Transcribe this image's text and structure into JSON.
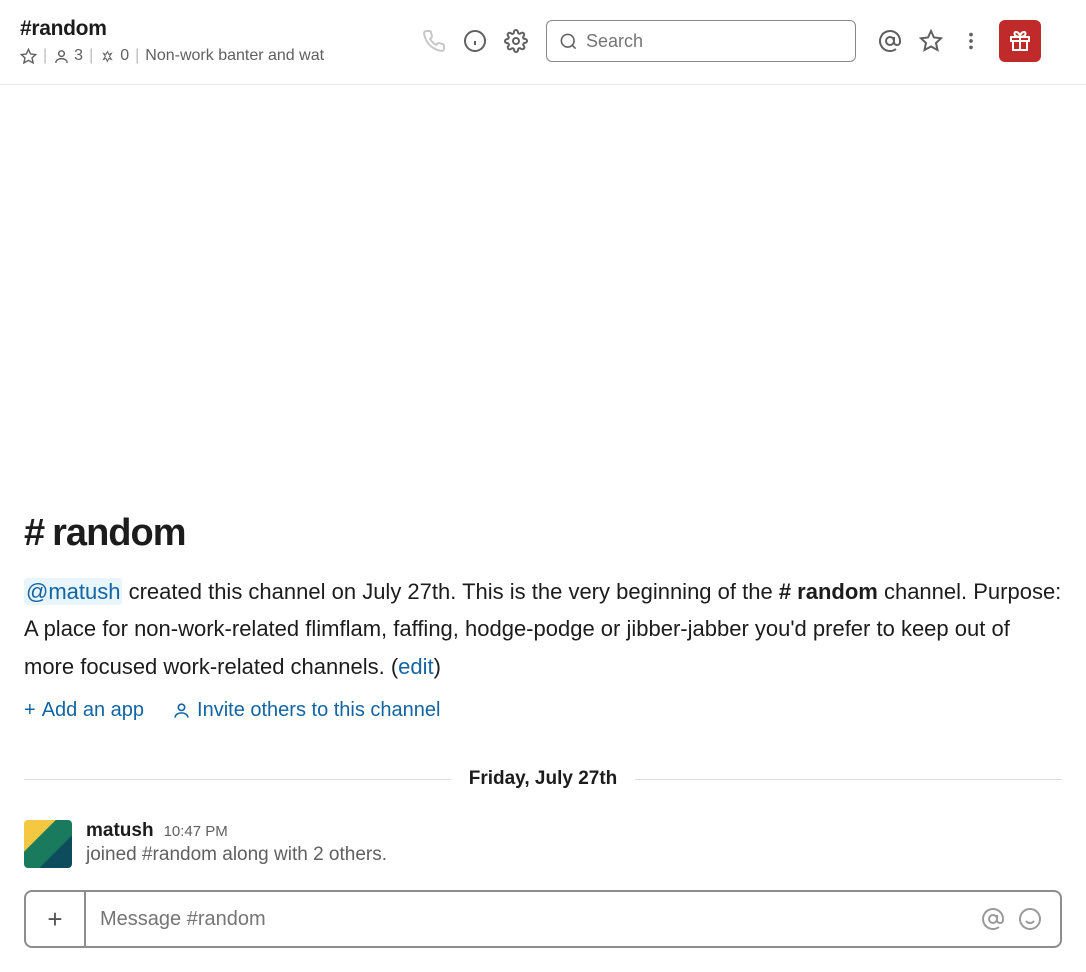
{
  "header": {
    "channel_name": "#random",
    "member_count": "3",
    "pin_count": "0",
    "topic": "Non-work banter and wat",
    "search_placeholder": "Search"
  },
  "intro": {
    "hash": "#",
    "name": "random",
    "creator": "@matush",
    "text1": " created this channel on July 27th. This is the very beginning of the ",
    "chname": " # random",
    "text2": " channel. Purpose: A place for non-work-related flimflam, faffing, hodge-podge or jibber-jabber you'd prefer to keep out of more focused work-related channels. (",
    "edit": "edit",
    "text3": ")",
    "add_app": "Add an app",
    "invite": "Invite others to this channel"
  },
  "divider": {
    "label": "Friday, July 27th"
  },
  "message": {
    "user": "matush",
    "time": "10:47 PM",
    "text": "joined #random along with 2 others."
  },
  "composer": {
    "placeholder": "Message #random"
  }
}
